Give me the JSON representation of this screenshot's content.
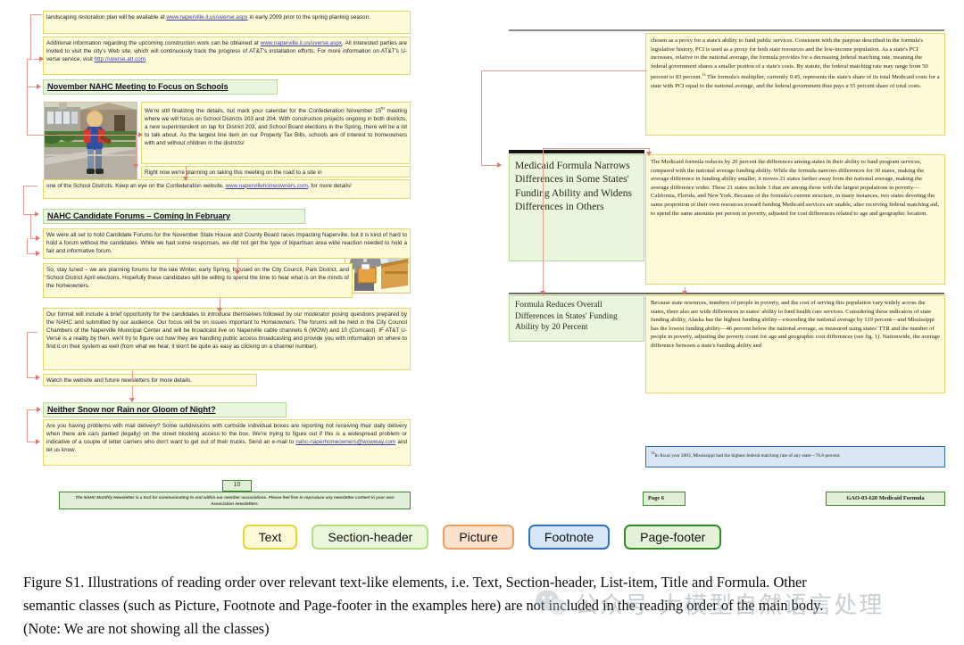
{
  "figure": {
    "caption_line1": "Figure S1.  Illustrations of reading order over relevant text-like elements, i.e.  Text, Section-header, List-item, Title and Formula.  Other",
    "caption_line2": "semantic classes (such as Picture, Footnote and Page-footer in the examples here) are not included in the reading order of the main body.",
    "caption_line3": "(Note: We are not showing all the classes)"
  },
  "watermark": {
    "text": "公众号 大模型自然语言处理"
  },
  "legend": {
    "items": [
      {
        "label": "Text",
        "key": "text"
      },
      {
        "label": "Section-header",
        "key": "section-header"
      },
      {
        "label": "Picture",
        "key": "picture"
      },
      {
        "label": "Footnote",
        "key": "footnote"
      },
      {
        "label": "Page-footer",
        "key": "page-footer"
      }
    ],
    "colors": {
      "text": "#e8d634",
      "section_header": "#b3e07c",
      "picture": "#ef9d5e",
      "footnote": "#2f72c4",
      "page_footer": "#2f8d22"
    }
  },
  "left_page": {
    "blocks": {
      "p1": "landscaping restoration plan will be available at www.naperville.il.us/uverse.aspx in early 2009 prior to the spring planting season.",
      "p1_link": "www.naperville.il.us/uverse.aspx",
      "p2_a": "Additional information regarding the upcoming construction work can be obtained at ",
      "p2_link1": "www.naperville.il.us/uverse.aspx",
      "p2_b": ". All interested parties are invited to visit the city's Web site, which will continuously track the progress of AT&T's installation efforts. For more information on AT&T's U-verse service, visit ",
      "p2_link2": "http://uverse.att.com",
      "h1": "November NAHC Meeting to Focus on Schools",
      "p3_a": "We're still finalizing the details, but mark your calendar for the Confederation November 15",
      "p3_sup": "th",
      "p3_b": " meeting where we will focus on School Districts 203 and 204.  With construction projects ongoing in both districts, a new superintendent on tap for District 203, and School Board elections in the Spring, there will be a lot to talk about.  As the largest line item on our Property Tax Bills, schools are of interest to homeowners with and without children in the districts!",
      "p4": "Right now we're planning on taking this meeting on the road to a site in",
      "p5_a": "one of the School Districts.  Keep an eye on the Confederation website, ",
      "p5_link": "www.napervillehomeowners.com",
      "p5_b": ", for more details!",
      "h2": "NAHC Candidate Forums – Coming In February",
      "p6": "We were all set to hold Candidate Forums for the November State House and County Board races impacting Naperville, but it is kind of hard to hold a forum without the candidates.  While we had some responses, we did not get the type of bipartisan area wide reaction needed to hold a fair and informative forum.",
      "p7": "So, stay tuned – we are planning forums for the late Winter, early Spring, focused on the City Council, Park District, and School District April elections.  Hopefully these candidates will be willing to spend the time to hear what is on the minds of the homeowners.",
      "p8": "Our format will include a brief opportunity for the candidates to introduce themselves followed by our moderator posing questions prepared by the NAHC and submitted by our audience.  Our focus will be on issues important to Homeowners.  The forums will be held in the City Council Chambers of the Naperville Municipal Center and will be broadcast live on Naperville cable channels 6 (WOW) and 10 (Comcast).  IF AT&T U-Verse is a reality by then, we'll try to figure out how they are handling public access broadcasting and provide you with information on where to find it on their system as well (from what we hear, it won't be quite as easy as clicking on a channel number).",
      "p9": "Watch the website and future newsletters for more details.",
      "h3": "Neither Snow nor Rain nor Gloom of Night?",
      "p10_a": "Are you having problems with mail delivery?  Some subdivisions with curbside individual boxes are reporting not receiving their daily delivery when there are cars parked (legally) on the street blocking access to the box.  We're trying to figure out if this is a widespread problem or indicative of a couple of letter carriers who don't want to get out of their trucks.  Send an e-mail to ",
      "p10_link": "nahc-naperhomeowners@wowway.com",
      "p10_b": " and let us know.",
      "page_number": "10",
      "page_footer": "The NAHC Monthly Newsletter is a tool for communicating to and within our member associations.  Please feel free to reproduce any newsletter content in your own Association newsletters."
    },
    "pictures": {
      "school_photo_alt": "child-with-backpack-walking-to-school",
      "voting_clipart_alt": "man-casting-ballot-illustration"
    }
  },
  "right_page": {
    "blocks": {
      "t1_a": "chosen as a proxy for a state's ability to fund public services. Consistent with the purpose described in the formula's legislative history, PCI is used as a proxy for both state resources and the low-income population. As a state's PCI increases, relative to the national average, the formula provides for a decreasing federal matching rate, meaning the federal government shares a smaller portion of a state's costs. By statute, the federal matching rate may range from 50 percent to 83 percent.",
      "t1_sup": "13",
      "t1_b": " The formula's multiplier, currently 0.45, represents the state's share of its total Medicaid costs for a state with PCI equal to the national average, and the federal government thus pays a 55 percent share of total costs.",
      "h1": "Medicaid Formula Narrows Differences in Some States' Funding Ability and Widens Differences in Others",
      "t2": "The Medicaid formula reduces by 20 percent the differences among states in their ability to fund program services, compared with the national average funding ability. While the formula narrows differences for 30 states, making the average difference in funding ability smaller, it moves 21 states farther away from the national average, making the average difference wider. These 21 states include 3 that are among those with the largest populations in poverty—California, Florida, and New York. Because of the formula's current structure, in many instances, two states devoting the same proportion of their own resources toward funding Medicaid services are unable, after receiving federal matching aid, to spend the same amounts per person in poverty, adjusted for cost differences related to age and geographic location.",
      "h2": "Formula Reduces Overall Differences in States' Funding Ability by 20 Percent",
      "t3": "Because state resources, numbers of people in poverty, and the cost of serving this population vary widely across the states, there also are wide differences in states' ability to fund health care services. Considering these indicators of state funding ability, Alaska has the highest funding ability—exceeding the national average by 119 percent—and Mississippi has the lowest funding ability—46 percent below the national average, as measured using states' TTR and the number of people in poverty, adjusting the poverty count for age and geographic cost differences (see fig. 1). Nationwide, the average difference between a state's funding ability and",
      "footnote_sup": "13",
      "footnote": "In fiscal year 2003, Mississippi had the highest federal matching rate of any state—76.6 percent.",
      "page_footer_left": "Page 6",
      "page_footer_right": "GAO-03-620  Medicaid Formula"
    }
  }
}
